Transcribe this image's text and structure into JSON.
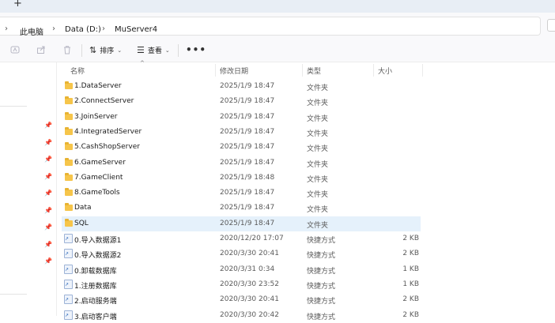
{
  "tabbar": {
    "new_tab": "+"
  },
  "breadcrumb": [
    {
      "label": "此电脑"
    },
    {
      "label": "Data (D:)"
    },
    {
      "label": "MuServer4"
    }
  ],
  "breadcrumb_sep": "›",
  "toolbar": {
    "sort_label": "排序",
    "view_label": "查看",
    "more_label": "•••"
  },
  "columns": {
    "name": "名称",
    "date": "修改日期",
    "type": "类型",
    "size": "大小"
  },
  "rows": [
    {
      "name": "1.DataServer",
      "date": "2025/1/9 18:47",
      "type": "文件夹",
      "size": "",
      "kind": "folder"
    },
    {
      "name": "2.ConnectServer",
      "date": "2025/1/9 18:47",
      "type": "文件夹",
      "size": "",
      "kind": "folder"
    },
    {
      "name": "3.JoinServer",
      "date": "2025/1/9 18:47",
      "type": "文件夹",
      "size": "",
      "kind": "folder"
    },
    {
      "name": "4.IntegratedServer",
      "date": "2025/1/9 18:47",
      "type": "文件夹",
      "size": "",
      "kind": "folder"
    },
    {
      "name": "5.CashShopServer",
      "date": "2025/1/9 18:47",
      "type": "文件夹",
      "size": "",
      "kind": "folder"
    },
    {
      "name": "6.GameServer",
      "date": "2025/1/9 18:47",
      "type": "文件夹",
      "size": "",
      "kind": "folder"
    },
    {
      "name": "7.GameClient",
      "date": "2025/1/9 18:48",
      "type": "文件夹",
      "size": "",
      "kind": "folder"
    },
    {
      "name": "8.GameTools",
      "date": "2025/1/9 18:47",
      "type": "文件夹",
      "size": "",
      "kind": "folder"
    },
    {
      "name": "Data",
      "date": "2025/1/9 18:47",
      "type": "文件夹",
      "size": "",
      "kind": "folder"
    },
    {
      "name": "SQL",
      "date": "2025/1/9 18:47",
      "type": "文件夹",
      "size": "",
      "kind": "folder",
      "selected": true
    },
    {
      "name": "0.导入数据源1",
      "date": "2020/12/20 17:07",
      "type": "快捷方式",
      "size": "2 KB",
      "kind": "shortcut"
    },
    {
      "name": "0.导入数据源2",
      "date": "2020/3/30 20:41",
      "type": "快捷方式",
      "size": "2 KB",
      "kind": "shortcut"
    },
    {
      "name": "0.卸载数据库",
      "date": "2020/3/31 0:34",
      "type": "快捷方式",
      "size": "1 KB",
      "kind": "shortcut"
    },
    {
      "name": "1.注册数据库",
      "date": "2020/3/30 23:52",
      "type": "快捷方式",
      "size": "1 KB",
      "kind": "shortcut"
    },
    {
      "name": "2.启动服务端",
      "date": "2020/3/30 20:41",
      "type": "快捷方式",
      "size": "2 KB",
      "kind": "shortcut"
    },
    {
      "name": "3.启动客户端",
      "date": "2020/3/30 20:42",
      "type": "快捷方式",
      "size": "2 KB",
      "kind": "shortcut"
    }
  ]
}
